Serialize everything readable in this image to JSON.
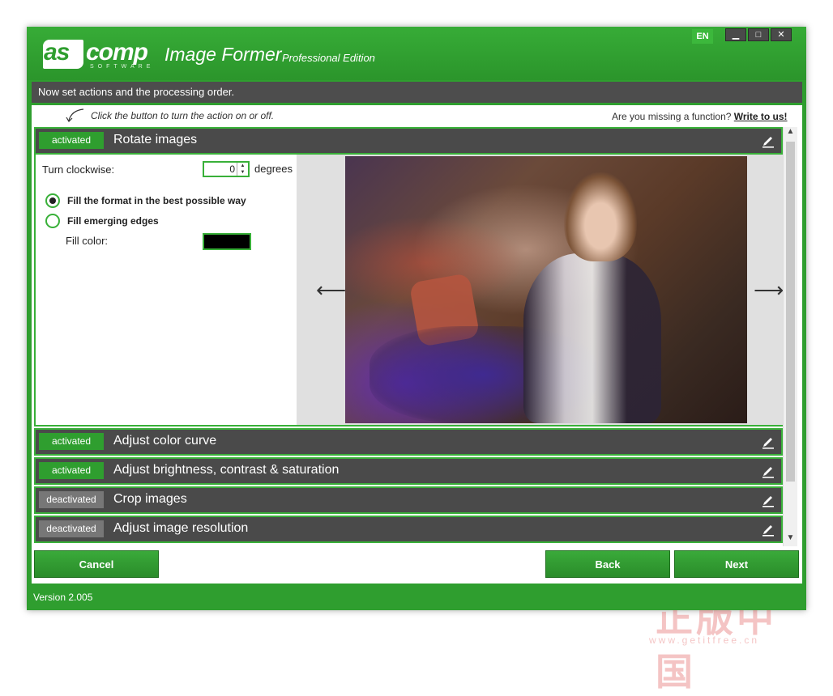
{
  "brand": {
    "logo_left": "as",
    "logo_right": "comp",
    "logo_sub": "SOFTWARE",
    "app_name": "Image Former",
    "edition": "Professional Edition"
  },
  "window": {
    "language": "EN",
    "minimize_glyph": "▁",
    "maximize_glyph": "□",
    "close_glyph": "✕"
  },
  "instruction": "Now set actions and the processing order.",
  "hint": "Click the button to turn the action on or off.",
  "missing": {
    "text": "Are you missing a function?",
    "link": "Write to us!"
  },
  "rotate": {
    "toggle": "activated",
    "title": "Rotate images",
    "clockwise_label": "Turn clockwise:",
    "degrees_value": "0",
    "degrees_unit": "degrees",
    "option_fill_format": "Fill the format in the best possible way",
    "option_fill_edges": "Fill emerging edges",
    "selected_option": "fill_format",
    "fill_color_label": "Fill color:",
    "fill_color": "#000000",
    "prev_arrow": "⟵",
    "next_arrow": "⟶"
  },
  "actions": [
    {
      "toggle": "activated",
      "title": "Adjust color curve",
      "active": true
    },
    {
      "toggle": "activated",
      "title": "Adjust brightness, contrast & saturation",
      "active": true
    },
    {
      "toggle": "deactivated",
      "title": "Crop images",
      "active": false
    },
    {
      "toggle": "deactivated",
      "title": "Adjust image resolution",
      "active": false
    }
  ],
  "buttons": {
    "cancel": "Cancel",
    "back": "Back",
    "next": "Next"
  },
  "version": "Version 2.005",
  "watermark": "正版中国",
  "watermark_sub": "www.getitfree.cn",
  "colors": {
    "brand_green": "#2f9e2f",
    "row_gray": "#4a4a4a",
    "deactivated_gray": "#777777"
  }
}
